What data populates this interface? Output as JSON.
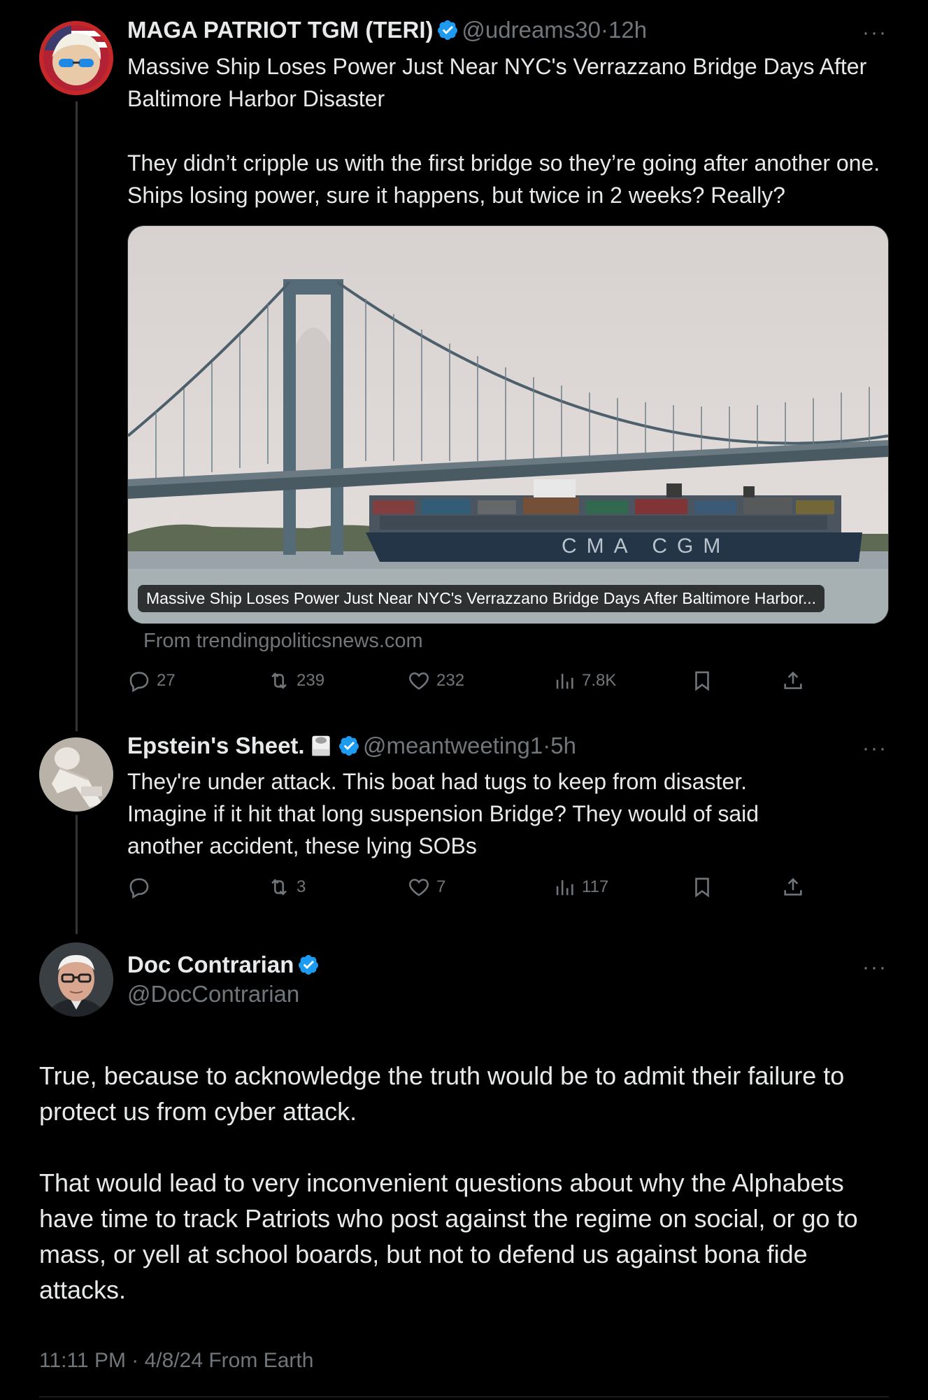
{
  "tweet1": {
    "name": "MAGA PATRIOT TGM (TERI)",
    "handle": "@udreams30",
    "time": "12h",
    "text": "Massive Ship Loses Power Just Near NYC's Verrazzano Bridge Days After Baltimore Harbor Disaster\n\nThey didn’t cripple us with the first bridge so they’re going after another one. Ships losing power, sure it happens, but twice in 2 weeks? Really?",
    "card": {
      "headline": "Massive Ship Loses Power Just Near NYC's Verrazzano Bridge Days After Baltimore Harbor...",
      "source": "From trendingpoliticsnews.com",
      "ship_text": "CMA CGM"
    },
    "stats": {
      "replies": "27",
      "reposts": "239",
      "likes": "232",
      "views": "7.8K"
    }
  },
  "tweet2": {
    "name": "Epstein's Sheet.",
    "handle": "@meantweeting1",
    "time": "5h",
    "text": "They're under attack. This boat had tugs to keep from disaster. Imagine if it hit that long suspension Bridge? They would of said another accident, these lying SOBs",
    "stats": {
      "replies": "",
      "reposts": "3",
      "likes": "7",
      "views": "117"
    }
  },
  "main": {
    "name": "Doc Contrarian",
    "handle": "@DocContrarian",
    "text_p1": "True, because to acknowledge the truth would be to admit their failure to protect us from cyber attack.",
    "text_p2": "That would lead to very inconvenient questions about why the Alphabets have time to track Patriots who post against the regime on social, or go to mass, or yell at school boards, but not to defend us against bona fide attacks.",
    "timestamp": "11:11 PM · 4/8/24 From Earth"
  },
  "more_label": "···",
  "sep": "·",
  "colors": {
    "background": "#000000",
    "verified": "#1d9bf0",
    "muted": "#71767b"
  }
}
